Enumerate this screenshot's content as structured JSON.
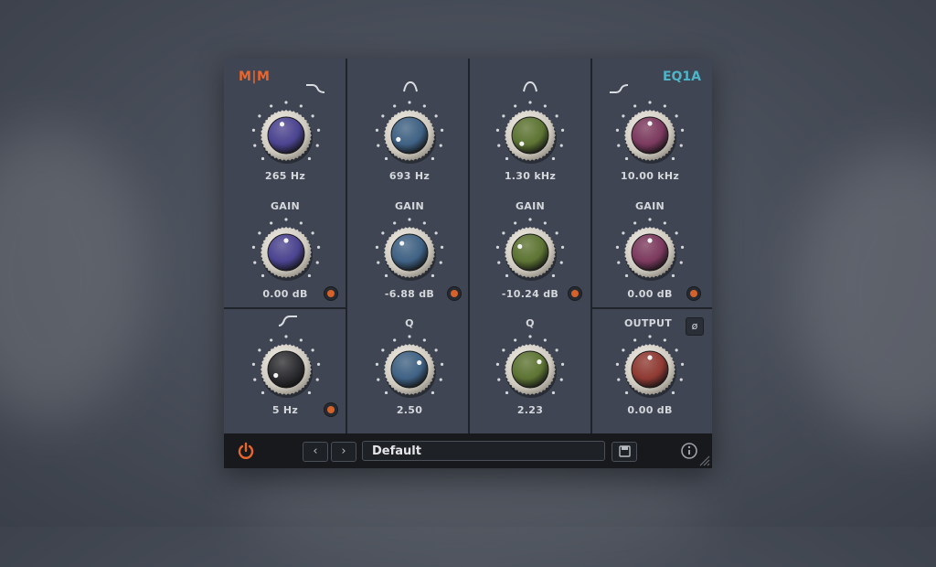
{
  "branding": {
    "left_logo": "M|M",
    "right_logo": "EQ1A"
  },
  "colors": {
    "accent_orange": "#e8662d",
    "accent_teal": "#4fb4c7",
    "knob_purple": "#4b4491",
    "knob_blue": "#3f6285",
    "knob_green": "#5d7433",
    "knob_plum": "#7c3a5f",
    "knob_red": "#8f3a33",
    "knob_dark": "#2e2f33"
  },
  "bands": {
    "low_shelf": {
      "shape_icon": "low-shelf-icon",
      "freq": "265 Hz",
      "gain_label": "GAIN",
      "gain": "0.00 dB"
    },
    "low_cut": {
      "shape_icon": "high-pass-icon",
      "freq": "5 Hz"
    },
    "low_mid": {
      "shape_icon": "bell-icon",
      "freq": "693 Hz",
      "gain_label": "GAIN",
      "gain": "-6.88 dB",
      "q_label": "Q",
      "q": "2.50"
    },
    "high_mid": {
      "shape_icon": "bell-icon",
      "freq": "1.30 kHz",
      "gain_label": "GAIN",
      "gain": "-10.24 dB",
      "q_label": "Q",
      "q": "2.23"
    },
    "high_shelf": {
      "shape_icon": "high-shelf-icon",
      "freq": "10.00 kHz",
      "gain_label": "GAIN",
      "gain": "0.00 dB"
    },
    "output": {
      "label": "OUTPUT",
      "gain": "0.00 dB",
      "phase_label": "ø"
    }
  },
  "footer": {
    "preset_name": "Default",
    "prev": "‹",
    "next": "›"
  }
}
